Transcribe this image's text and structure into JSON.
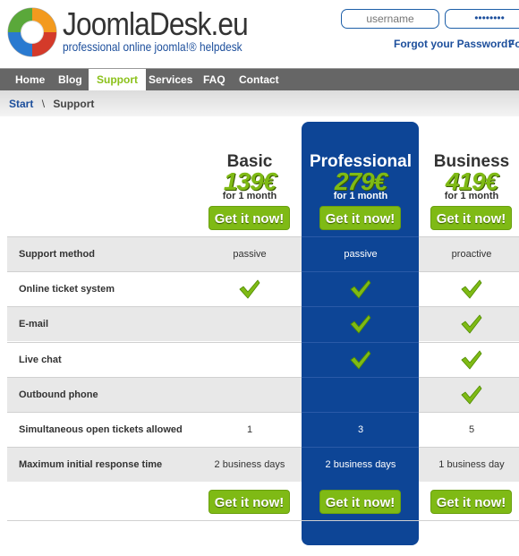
{
  "header": {
    "logo_title": "JoomlaDesk.eu",
    "logo_subtitle": "professional online joomla!® helpdesk",
    "username_placeholder": "username",
    "password_value": "••••••••",
    "forgot_password": "Forgot your Password?",
    "forgot_username_partial": "Fo"
  },
  "nav": {
    "items": [
      "Home",
      "Blog",
      "Support",
      "Services",
      "FAQ",
      "Contact"
    ],
    "active": "Support"
  },
  "breadcrumb": {
    "start": "Start",
    "sep": "\\",
    "current": "Support"
  },
  "plans": [
    {
      "name": "Basic",
      "price": "139€",
      "period": "for 1 month",
      "cta": "Get it now!"
    },
    {
      "name": "Professional",
      "price": "279€",
      "period": "for 1 month",
      "cta": "Get it now!"
    },
    {
      "name": "Business",
      "price": "419€",
      "period": "for 1 month",
      "cta": "Get it now!"
    }
  ],
  "features": [
    {
      "label": "Support method",
      "values": [
        "passive",
        "passive",
        "proactive"
      ]
    },
    {
      "label": "Online ticket system",
      "values": [
        true,
        true,
        true
      ]
    },
    {
      "label": "E-mail",
      "values": [
        false,
        true,
        true
      ]
    },
    {
      "label": "Live chat",
      "values": [
        false,
        true,
        true
      ]
    },
    {
      "label": "Outbound phone",
      "values": [
        false,
        false,
        true
      ]
    },
    {
      "label": "Simultaneous open tickets allowed",
      "values": [
        "1",
        "3",
        "5"
      ]
    },
    {
      "label": "Maximum initial response time",
      "values": [
        "2 business days",
        "2 business days",
        "1 business day"
      ]
    }
  ],
  "colors": {
    "accent_green": "#7fba15",
    "highlight_blue": "#0d4596",
    "nav_bg": "#666666"
  }
}
